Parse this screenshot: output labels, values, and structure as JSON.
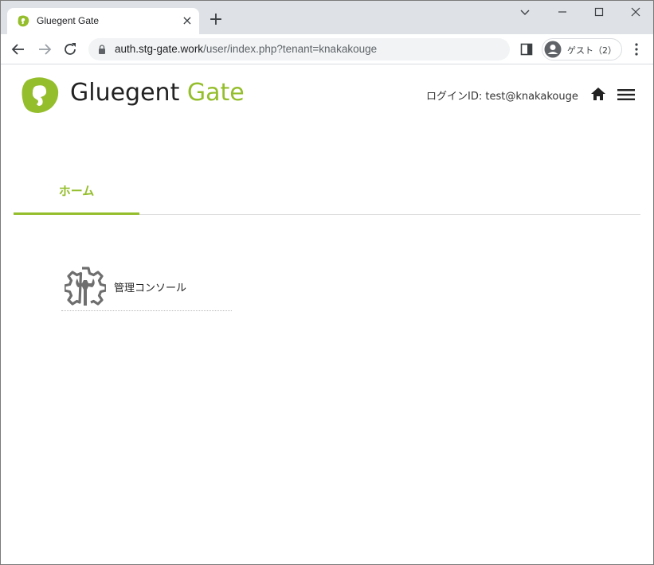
{
  "browser": {
    "tab_title": "Gluegent Gate",
    "tab_close": "×",
    "new_tab": "+",
    "url_host": "auth.stg-gate.work",
    "url_path": "/user/index.php?tenant=knakakouge",
    "profile_label": "ゲスト（2）"
  },
  "header": {
    "logo_word1": "Gluegent",
    "logo_word2": "Gate",
    "login_label": "ログインID: test@knakakouge"
  },
  "tabs": [
    {
      "label": "ホーム",
      "active": true
    }
  ],
  "apps": [
    {
      "label": "管理コンソール",
      "icon": "gear-wrench-icon"
    }
  ],
  "colors": {
    "accent": "#95be2c",
    "tabstrip": "#dee1e6",
    "text": "#333333"
  }
}
